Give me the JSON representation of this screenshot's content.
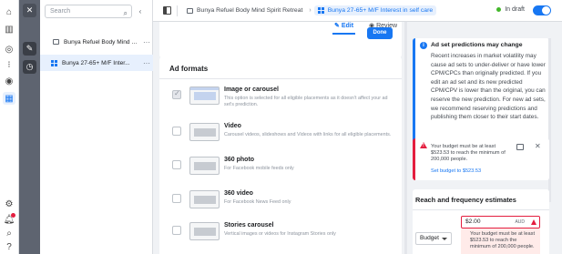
{
  "tree": {
    "search_placeholder": "Search",
    "items": [
      {
        "label": "Bunya Refuel Body Mind S..."
      },
      {
        "label": "Bunya 27-65+ M/F Inter..."
      }
    ]
  },
  "topbar": {
    "breadcrumb": [
      {
        "label": "Bunya Refuel Body Mind Spirit Retreat"
      },
      {
        "label": "Bunya 27-65+ M/F Interest in self care"
      }
    ],
    "status": "In draft"
  },
  "editor": {
    "edit_tab": "Edit",
    "review_tab": "Review",
    "done_button": "Done"
  },
  "ad_formats": {
    "title": "Ad formats",
    "options": [
      {
        "title": "Image or carousel",
        "desc": "This option is selected for all eligible placements as it doesn't affect your ad set's prediction.",
        "checked": true
      },
      {
        "title": "Video",
        "desc": "Carousel videos, slideshows and Videos with links for all eligible placements.",
        "checked": false
      },
      {
        "title": "360 photo",
        "desc": "For Facebook mobile feeds only",
        "checked": false
      },
      {
        "title": "360 video",
        "desc": "For Facebook News Feed only",
        "checked": false
      },
      {
        "title": "Stories carousel",
        "desc": "Vertical images or videos for Instagram Stories only",
        "checked": false
      }
    ]
  },
  "info": {
    "title": "Ad set predictions may change",
    "body": "Recent increases in market volatility may cause ad sets to under-deliver or have lower CPM/CPCs than originally predicted. If you edit an ad set and its new predicted CPM/CPV is lower than the original, you can reserve the new prediction. For new ad sets, we recommend reserving predictions and publishing them closer to their start dates."
  },
  "warning": {
    "text": "Your budget must be at least $523.53 to reach the minimum of 200,000 people.",
    "link": "Set budget to $523.53"
  },
  "reach": {
    "title": "Reach and frequency estimates",
    "budget_value": "$2.00",
    "currency": "AUD",
    "budget_type": "Budget",
    "error": "Your budget must be at least $523.53 to reach the minimum of 200,000 people."
  },
  "colors": {
    "accent": "#1877f2",
    "error": "#e41e3f",
    "draft_dot": "#42b72a"
  }
}
